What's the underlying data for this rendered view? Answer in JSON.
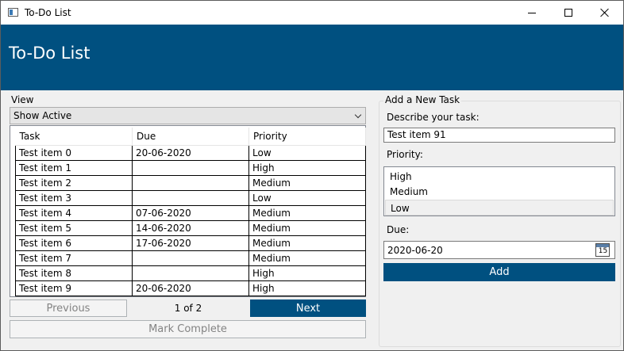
{
  "window": {
    "title": "To-Do List"
  },
  "header": {
    "title": "To-Do List"
  },
  "view": {
    "label": "View",
    "selected": "Show Active"
  },
  "grid": {
    "columns": [
      "Task",
      "Due",
      "Priority"
    ],
    "rows": [
      [
        "Test item 0",
        "20-06-2020",
        "Low"
      ],
      [
        "Test item 1",
        "",
        "High"
      ],
      [
        "Test item 2",
        "",
        "Medium"
      ],
      [
        "Test item 3",
        "",
        "Low"
      ],
      [
        "Test item 4",
        "07-06-2020",
        "Medium"
      ],
      [
        "Test item 5",
        "14-06-2020",
        "Medium"
      ],
      [
        "Test item 6",
        "17-06-2020",
        "Medium"
      ],
      [
        "Test item 7",
        "",
        "Medium"
      ],
      [
        "Test item 8",
        "",
        "High"
      ],
      [
        "Test item 9",
        "20-06-2020",
        "High"
      ]
    ]
  },
  "pager": {
    "previous_label": "Previous",
    "page_text": "1 of 2",
    "next_label": "Next"
  },
  "mark_complete_label": "Mark Complete",
  "add_task": {
    "group_label": "Add a New Task",
    "describe_label": "Describe your task:",
    "describe_value": "Test item 91",
    "priority_label": "Priority:",
    "priority_options": [
      "High",
      "Medium",
      "Low"
    ],
    "priority_selected": "Low",
    "due_label": "Due:",
    "due_value": "2020-06-20",
    "calendar_day": "15",
    "add_label": "Add"
  },
  "colors": {
    "accent": "#005080",
    "background": "#f0f0f0"
  }
}
